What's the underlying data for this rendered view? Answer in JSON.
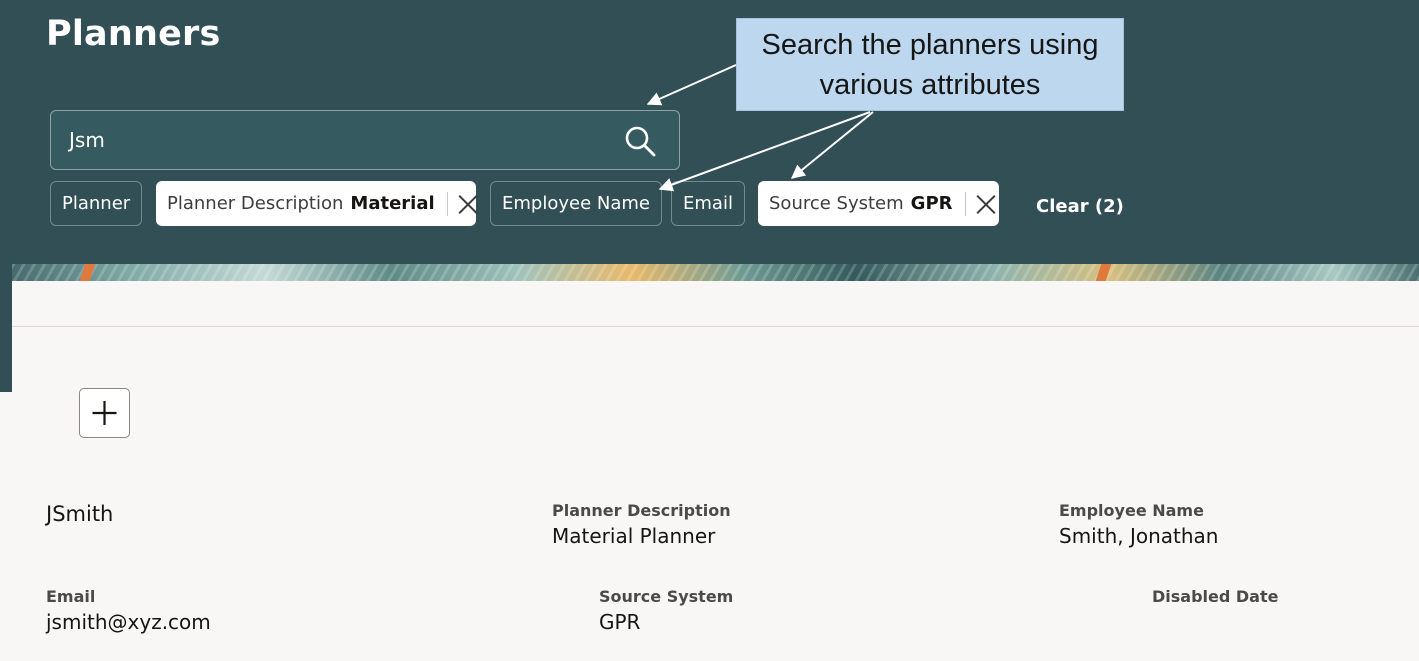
{
  "page": {
    "title": "Planners"
  },
  "search": {
    "value": "Jsm"
  },
  "filters": {
    "planner": {
      "label": "Planner"
    },
    "planner_description": {
      "label": "Planner Description",
      "value": "Material"
    },
    "employee_name": {
      "label": "Employee Name"
    },
    "email": {
      "label": "Email"
    },
    "source_system": {
      "label": "Source System",
      "value": "GPR"
    },
    "clear_label": "Clear (2)"
  },
  "callout": {
    "line1": "Search the planners using",
    "line2": "various attributes"
  },
  "record": {
    "planner": "JSmith",
    "planner_description_label": "Planner Description",
    "planner_description": "Material Planner",
    "employee_name_label": "Employee Name",
    "employee_name": "Smith, Jonathan",
    "email_label": "Email",
    "email": "jsmith@xyz.com",
    "source_system_label": "Source System",
    "source_system": "GPR",
    "disabled_date_label": "Disabled Date"
  },
  "icons": {
    "search": "search-icon",
    "remove_filter": "close-icon",
    "add": "plus-icon"
  },
  "colors": {
    "header_bg": "#314f55",
    "content_bg": "#f8f7f5",
    "callout_bg": "#bdd7ee"
  }
}
